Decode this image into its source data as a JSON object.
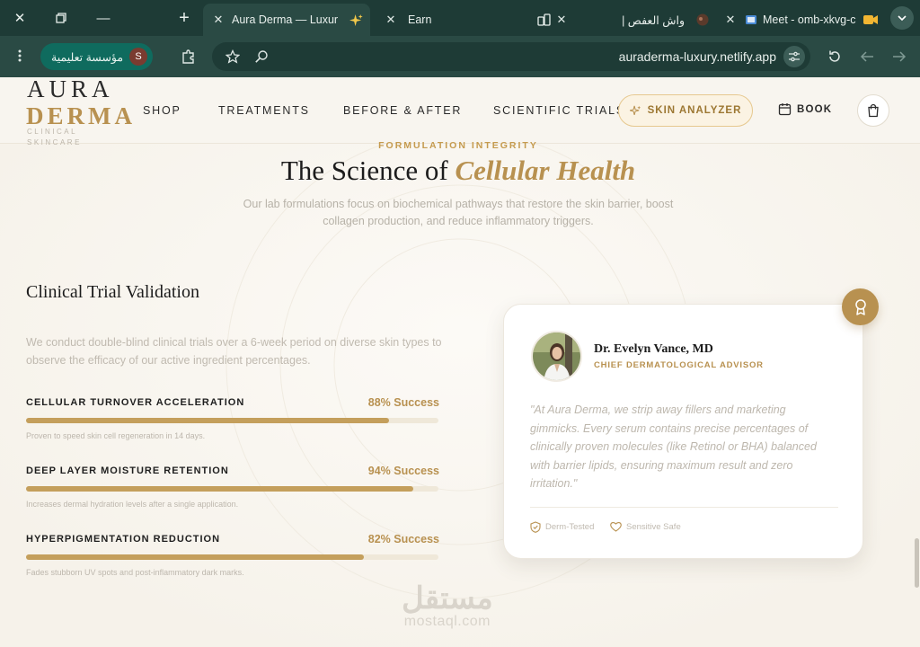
{
  "browser": {
    "tabs": [
      {
        "title": "Aura Derma — Luxury",
        "active": true
      },
      {
        "title": "Earn",
        "active": false
      },
      {
        "title": "واش العفص |",
        "active": false
      },
      {
        "title": "Meet - omb-xkvg-c",
        "active": false
      }
    ],
    "profile_label": "مؤسسة تعليمية",
    "profile_initial": "S",
    "url": "auraderma-luxury.netlify.app"
  },
  "nav": {
    "logo_line1": "AURA",
    "logo_line2": "DERMA",
    "logo_line3": "CLINICAL",
    "logo_line4": "SKINCARE",
    "links": [
      "SHOP",
      "TREATMENTS",
      "BEFORE & AFTER",
      "SCIENTIFIC TRIALS"
    ],
    "analyzer_label": "SKIN ANALYZER",
    "book_label": "BOOK"
  },
  "hero": {
    "eyebrow": "FORMULATION INTEGRITY",
    "title_plain": "The Science of ",
    "title_accent": "Cellular Health",
    "subtitle": "Our lab formulations focus on biochemical pathways that restore the skin barrier, boost collagen production, and reduce inflammatory triggers."
  },
  "trials": {
    "heading": "Clinical Trial Validation",
    "intro": "We conduct double-blind clinical trials over a 6-week period on diverse skin types to observe the efficacy of our active ingredient percentages.",
    "metrics": [
      {
        "label": "CELLULAR TURNOVER ACCELERATION",
        "value": 88,
        "value_text": "88% Success",
        "note": "Proven to speed skin cell regeneration in 14 days."
      },
      {
        "label": "DEEP LAYER MOISTURE RETENTION",
        "value": 94,
        "value_text": "94% Success",
        "note": "Increases dermal hydration levels after a single application."
      },
      {
        "label": "HYPERPIGMENTATION REDUCTION",
        "value": 82,
        "value_text": "82% Success",
        "note": "Fades stubborn UV spots and post-inflammatory dark marks."
      }
    ]
  },
  "advisor": {
    "name": "Dr. Evelyn Vance, MD",
    "role": "CHIEF DERMATOLOGICAL ADVISOR",
    "quote": "\"At Aura Derma, we strip away fillers and marketing gimmicks. Every serum contains precise percentages of clinically proven molecules (like Retinol or BHA) balanced with barrier lipids, ensuring maximum result and zero irritation.\"",
    "tags": [
      "Derm-Tested",
      "Sensitive Safe"
    ]
  },
  "watermark": {
    "arabic": "مستقل",
    "latin": "mostaql.com"
  },
  "colors": {
    "gold": "#b89150",
    "chrome": "#1e3b36",
    "background": "#f8f5ef"
  }
}
